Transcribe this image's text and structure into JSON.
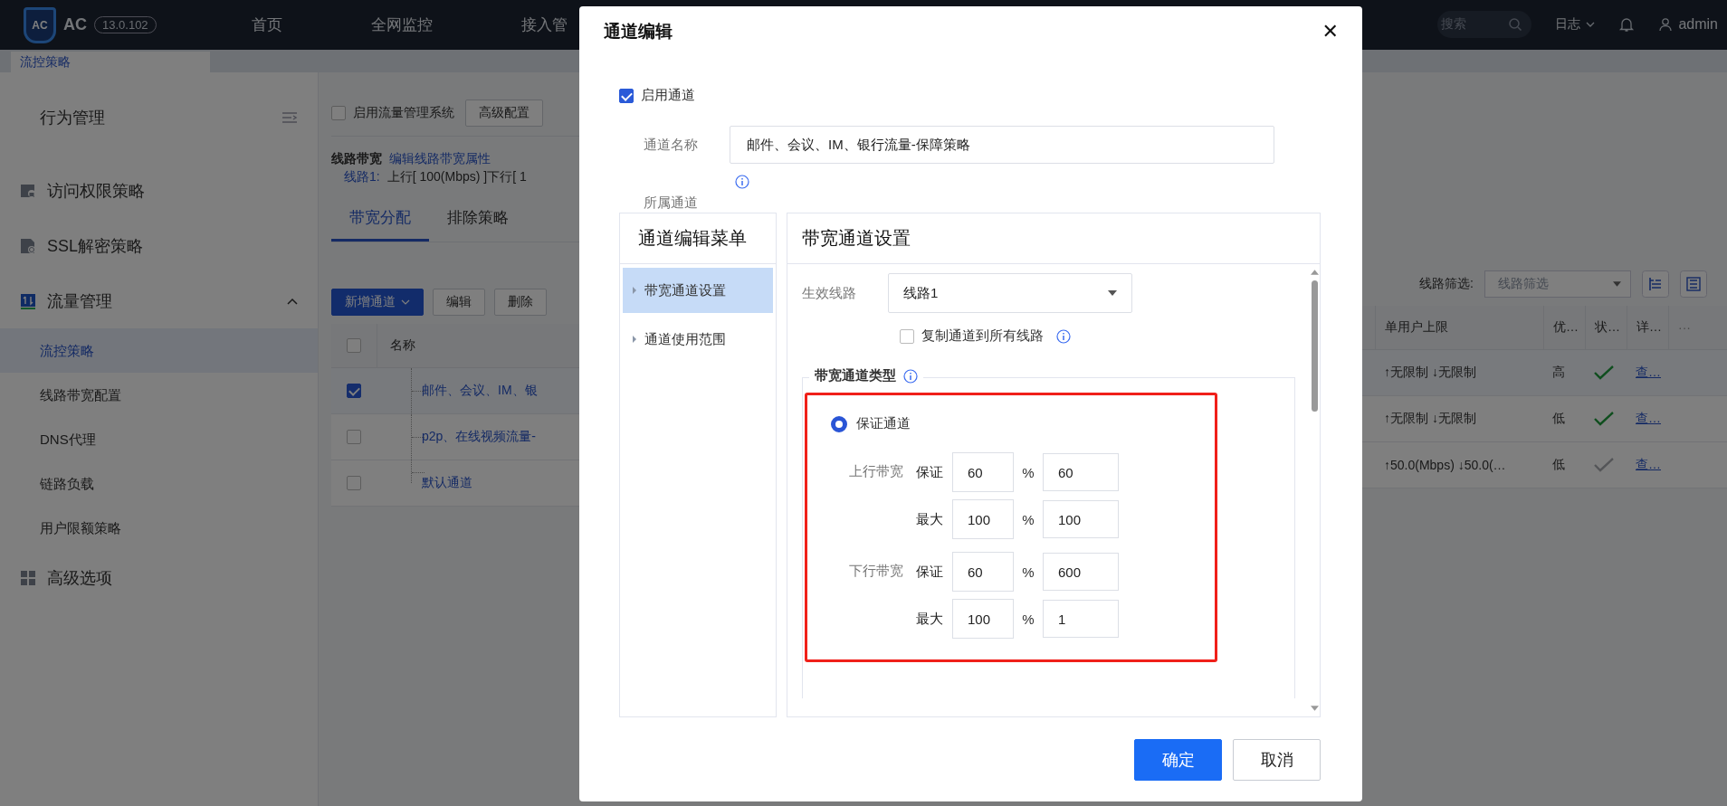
{
  "topbar": {
    "logo": "AC",
    "product": "AC",
    "version": "13.0.102",
    "nav": [
      {
        "label": "首页"
      },
      {
        "label": "全网监控"
      },
      {
        "label": "接入管"
      }
    ],
    "search": {
      "placeholder": "搜索"
    },
    "log_menu": "日志",
    "user": "admin"
  },
  "page_tabs": [
    {
      "label": "流控策略",
      "selected": true
    }
  ],
  "sidebar": {
    "title": "行为管理",
    "items": [
      {
        "label": "访问权限策略",
        "kind": "lock"
      },
      {
        "label": "SSL解密策略",
        "kind": "doc"
      },
      {
        "label": "流量管理",
        "kind": "traffic",
        "expanded": true,
        "children": [
          {
            "label": "流控策略",
            "selected": true
          },
          {
            "label": "线路带宽配置",
            "selected": false
          },
          {
            "label": "DNS代理",
            "selected": false
          },
          {
            "label": "链路负载",
            "selected": false
          },
          {
            "label": "用户限额策略",
            "selected": false
          }
        ]
      },
      {
        "label": "高级选项",
        "kind": "grid"
      }
    ]
  },
  "content": {
    "enable_system": {
      "label": "启用流量管理系统",
      "checked": false
    },
    "advanced_button": "高级配置",
    "bandwidth": {
      "title": "线路带宽",
      "edit_link": "编辑线路带宽属性",
      "line_label": "线路1:",
      "line_value": "上行[ 100(Mbps) ]下行[ 1"
    },
    "tabs": [
      {
        "label": "带宽分配",
        "selected": true
      },
      {
        "label": "排除策略",
        "selected": false
      }
    ],
    "toolbar": {
      "add_button": "新增通道",
      "edit_button": "编辑",
      "delete_button": "删除",
      "filter_label": "线路筛选:",
      "filter_placeholder": "线路筛选"
    },
    "table": {
      "select_all": {
        "checked": false
      },
      "columns": [
        "名称",
        "单用户上限",
        "优…",
        "状…",
        "详…",
        "···"
      ],
      "rows": [
        {
          "selected": true,
          "name": "邮件、会议、IM、银",
          "user_limit": "↑无限制 ↓无限制",
          "priority": "高",
          "enabled": true,
          "detail": "查…"
        },
        {
          "selected": false,
          "name": "p2p、在线视频流量-",
          "user_limit": "↑无限制 ↓无限制",
          "priority": "低",
          "enabled": true,
          "detail": "查…"
        },
        {
          "selected": false,
          "name": "默认通道",
          "user_limit": "↑50.0(Mbps) ↓50.0(…",
          "priority": "低",
          "enabled": false,
          "detail": "查…"
        }
      ]
    }
  },
  "dialog": {
    "title": "通道编辑",
    "close": "✕",
    "enable_channel": {
      "label": "启用通道",
      "checked": true
    },
    "name_label": "通道名称",
    "name_value": "邮件、会议、IM、银行流量-保障策略",
    "parent_label": "所属通道",
    "menu": {
      "title": "通道编辑菜单",
      "items": [
        {
          "label": "带宽通道设置",
          "selected": true
        },
        {
          "label": "通道使用范围",
          "selected": false
        }
      ]
    },
    "panel": {
      "title": "带宽通道设置",
      "line_label": "生效线路",
      "line_value": "线路1",
      "copy_all": {
        "label": "复制通道到所有线路",
        "checked": false
      },
      "type_legend": "带宽通道类型",
      "highlighted": true,
      "type_option": {
        "label": "保证通道",
        "selected": true
      },
      "groups": [
        {
          "label": "上行带宽",
          "rows": [
            {
              "label": "保证",
              "percent": "60",
              "unit": "%",
              "value": "60"
            },
            {
              "label": "最大",
              "percent": "100",
              "unit": "%",
              "value": "100"
            }
          ]
        },
        {
          "label": "下行带宽",
          "rows": [
            {
              "label": "保证",
              "percent": "60",
              "unit": "%",
              "value": "600"
            },
            {
              "label": "最大",
              "percent": "100",
              "unit": "%",
              "value": "1"
            }
          ]
        }
      ]
    },
    "buttons": [
      {
        "label": "确定",
        "kind": "primary"
      },
      {
        "label": "取消",
        "kind": "default"
      }
    ]
  }
}
